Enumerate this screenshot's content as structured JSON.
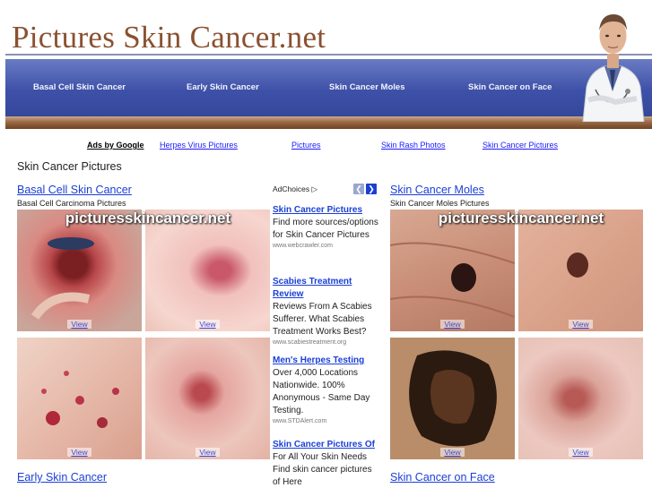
{
  "header": {
    "site_title": "Pictures Skin Cancer.net",
    "nav": [
      "Basal Cell Skin Cancer",
      "Early Skin Cancer",
      "Skin Cancer Moles",
      "Skin Cancer on Face"
    ]
  },
  "ad_row": {
    "ads_by": "Ads by Google",
    "links": [
      "Herpes Virus Pictures",
      "Pictures",
      "Skin Rash Photos",
      "Skin Cancer Pictures"
    ]
  },
  "page_title": "Skin Cancer Pictures",
  "watermark": "picturesskincancer.net",
  "view_label": "View",
  "sections": {
    "basal": {
      "title": "Basal Cell Skin Cancer",
      "subtitle": "Basal Cell Carcinoma Pictures"
    },
    "moles": {
      "title": "Skin Cancer Moles",
      "subtitle": "Skin Cancer Moles Pictures"
    },
    "early": {
      "title": "Early Skin Cancer"
    },
    "face": {
      "title": "Skin Cancer on Face"
    }
  },
  "ads": {
    "adchoices": "AdChoices",
    "items": [
      {
        "title": "Skin Cancer Pictures",
        "desc": "Find more sources/options for Skin Cancer Pictures",
        "url": "www.webcrawler.com"
      },
      {
        "title": "Scabies Treatment Review",
        "desc": "Reviews From A Scabies Sufferer. What Scabies Treatment Works Best?",
        "url": "www.scabiestreatment.org"
      },
      {
        "title": "Men's Herpes Testing",
        "desc": "Over 4,000 Locations Nationwide. 100% Anonymous - Same Day Testing.",
        "url": "www.STDAlert.com"
      },
      {
        "title": "Skin Cancer Pictures Of",
        "desc": "For All Your Skin Needs Find skin cancer pictures of Here",
        "url": ""
      }
    ]
  },
  "colors": {
    "nav_blue": "#3e51a8",
    "title_brown": "#8a5130",
    "link_blue": "#1a3fd6"
  }
}
